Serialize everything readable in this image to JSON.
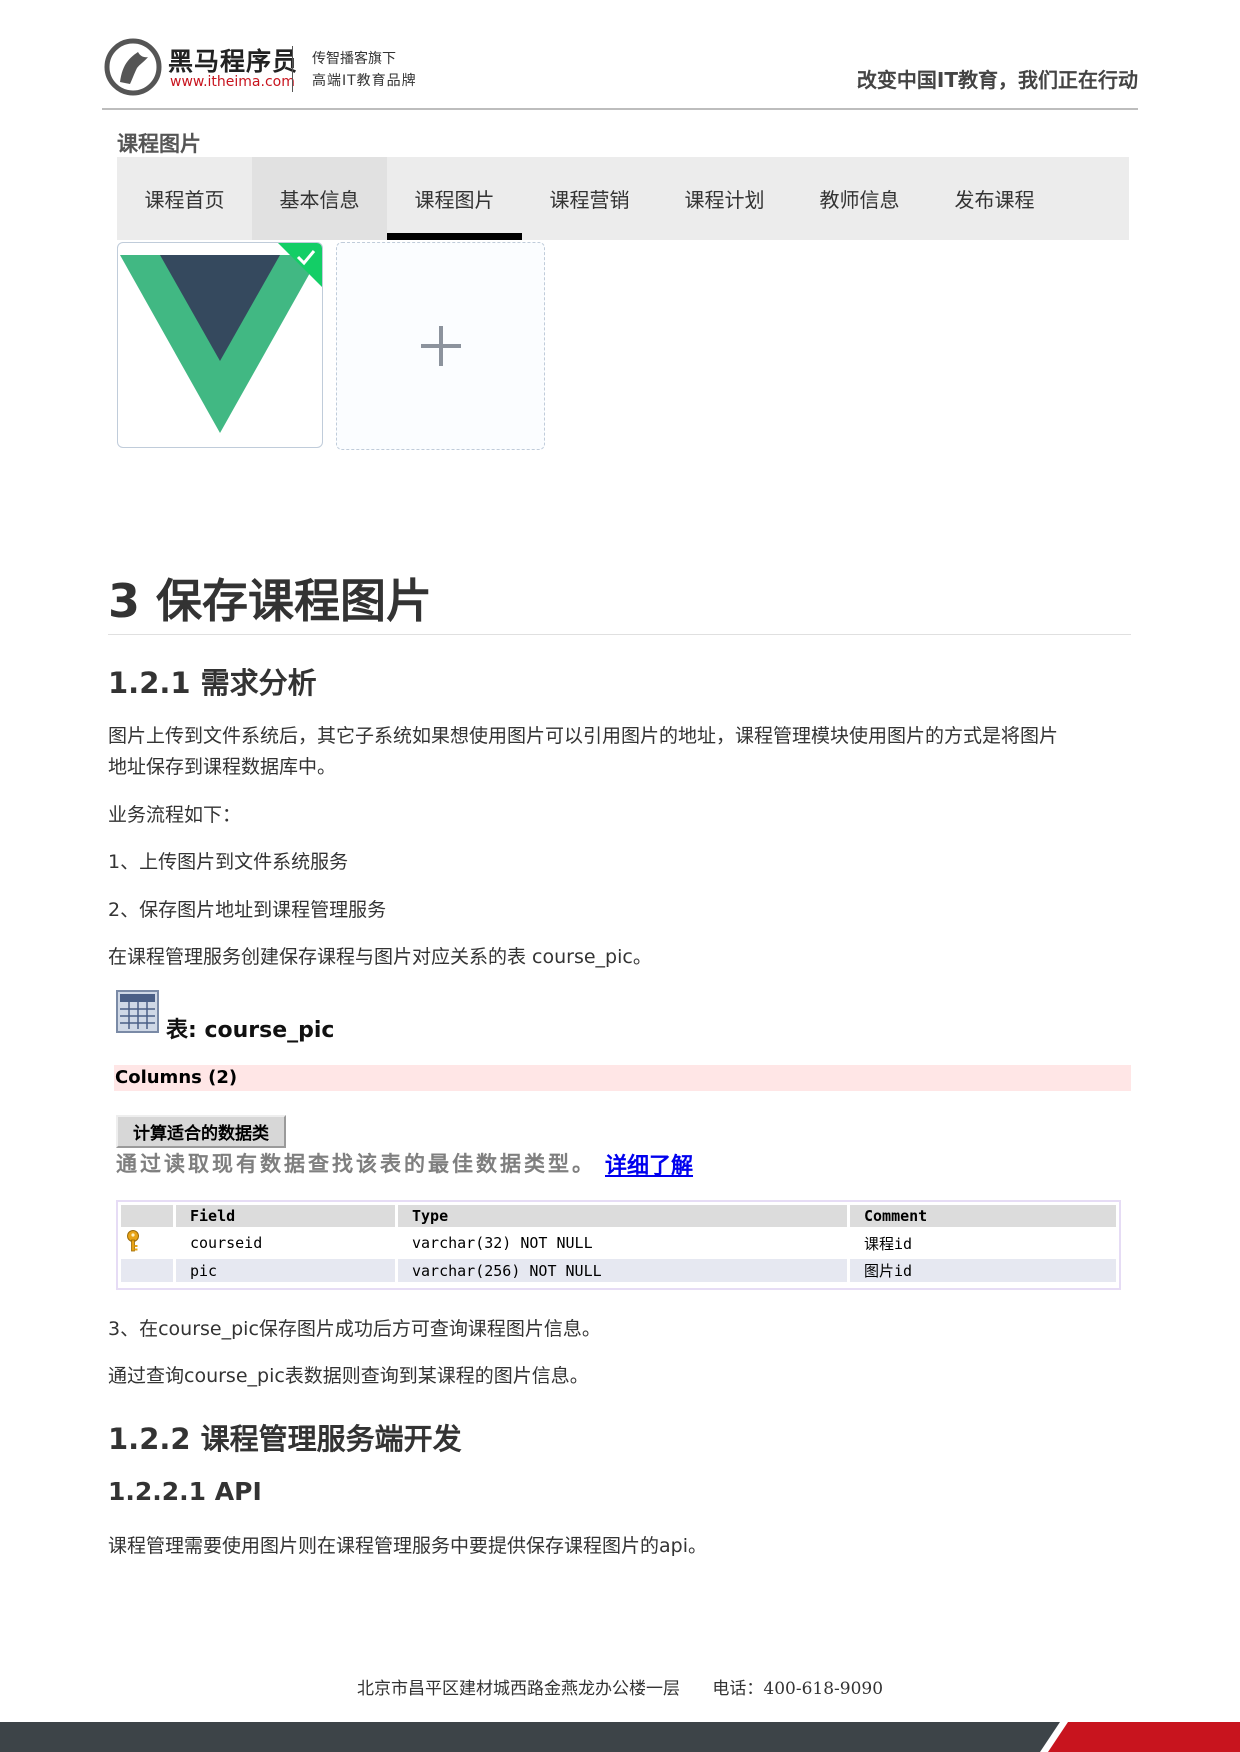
{
  "header": {
    "brand_name": "黑马程序员",
    "brand_url": "www.itheima.com",
    "brand_sub1": "传智播客旗下",
    "brand_sub2": "高端IT教育品牌",
    "slogan": "改变中国IT教育，我们正在行动"
  },
  "screenshot": {
    "title": "课程图片",
    "tabs": [
      {
        "label": "课程首页"
      },
      {
        "label": "基本信息"
      },
      {
        "label": "课程图片"
      },
      {
        "label": "课程营销"
      },
      {
        "label": "课程计划"
      },
      {
        "label": "教师信息"
      },
      {
        "label": "发布课程"
      }
    ],
    "active_tab": "课程图片",
    "hover_tab": "基本信息"
  },
  "section": {
    "title": "3 保存课程图片",
    "sub_title": "1.2.1 需求分析",
    "p1_line1": "图片上传到文件系统后，其它子系统如果想使用图片可以引用图片的地址，课程管理模块使用图片的方式是将图片",
    "p1_line2": "地址保存到课程数据库中。",
    "p2": "业务流程如下：",
    "p3": "1、上传图片到文件系统服务",
    "p4": "2、保存图片地址到课程管理服务",
    "p5": "在课程管理服务创建保存课程与图片对应关系的表 course_pic。"
  },
  "table_info": {
    "title": "表: course_pic",
    "columns_label": "Columns (2)",
    "calc_button": "计算适合的数据类",
    "calc_note": "通过读取现有数据查找该表的最佳数据类型。",
    "calc_link": "详细了解",
    "headers": [
      "Field",
      "Type",
      "Comment"
    ],
    "rows": [
      {
        "field": "courseid",
        "type": "varchar(32) NOT NULL",
        "comment": "课程id",
        "primary_key": true
      },
      {
        "field": "pic",
        "type": "varchar(256) NOT NULL",
        "comment": "图片id",
        "primary_key": false
      }
    ]
  },
  "after": {
    "p6": "3、在course_pic保存图片成功后方可查询课程图片信息。",
    "p7": "通过查询course_pic表数据则查询到某课程的图片信息。",
    "h2b": "1.2.2 课程管理服务端开发",
    "h3": "1.2.2.1 API",
    "p8": "课程管理需要使用图片则在课程管理服务中要提供保存课程图片的api。"
  },
  "footer": {
    "address": "北京市昌平区建材城西路金燕龙办公楼一层",
    "phone": "电话：400-618-9090"
  },
  "colors": {
    "brand_red": "#c8141e",
    "vue_green": "#41b883",
    "vue_dark": "#35495e",
    "footer_dark": "#3d4448"
  }
}
